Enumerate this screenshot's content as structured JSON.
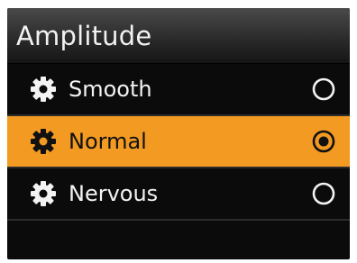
{
  "header": {
    "title": "Amplitude"
  },
  "menu": {
    "items": [
      {
        "label": "Smooth",
        "icon": "gear-icon",
        "selected": false
      },
      {
        "label": "Normal",
        "icon": "gear-icon",
        "selected": true
      },
      {
        "label": "Nervous",
        "icon": "gear-icon",
        "selected": false
      }
    ]
  },
  "colors": {
    "background": "#0b0b0b",
    "selected_background": "#f29a22",
    "text": "#f3f3f3",
    "selected_text": "#111111"
  }
}
